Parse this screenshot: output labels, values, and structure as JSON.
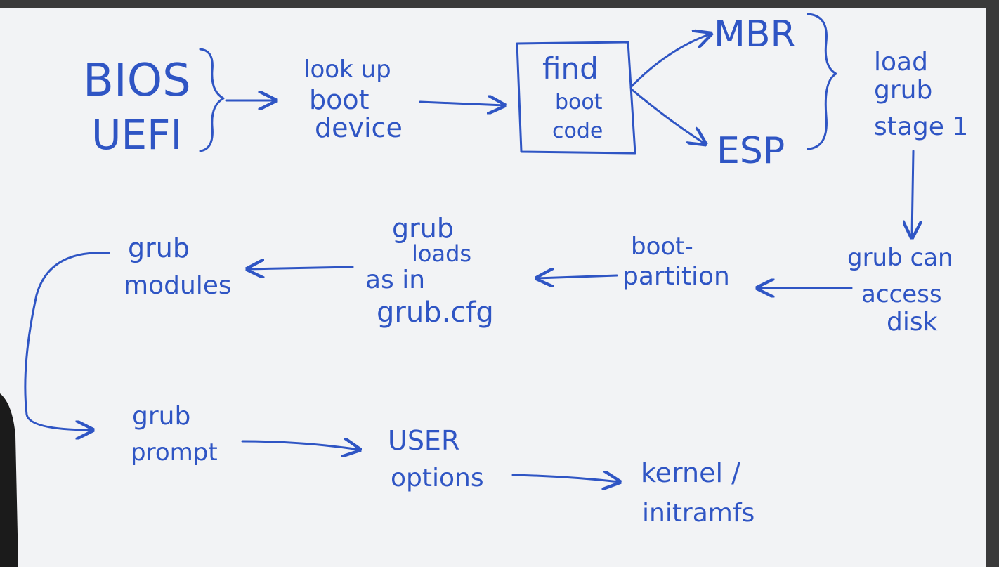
{
  "colors": {
    "ink": "#2f55c4",
    "board": "#f3f4f6",
    "frame": "#3a3a3a"
  },
  "nodes": {
    "bios": "BIOS",
    "uefi": "UEFI",
    "lookup_l1": "look up",
    "lookup_l2": "boot",
    "lookup_l3": "device",
    "find_l1": "find",
    "find_l2": "boot",
    "find_l3": "code",
    "mbr": "MBR",
    "esp": "ESP",
    "load_l1": "load",
    "load_l2": "grub",
    "load_l3": "stage 1",
    "scan_l1": "grub can",
    "scan_l2": "access",
    "scan_l3": "disk",
    "bootpart_l1": "boot-",
    "bootpart_l2": "partition",
    "grubloads_l1": "grub",
    "grubloads_l2": "loads",
    "grubloads_l3": "as in",
    "grubloads_l4": "grub.cfg",
    "modules_l1": "grub",
    "modules_l2": "modules",
    "prompt_l1": "grub",
    "prompt_l2": "prompt",
    "user_l1": "USER",
    "user_l2": "options",
    "kernel_l1": "kernel /",
    "kernel_l2": "initramfs"
  }
}
